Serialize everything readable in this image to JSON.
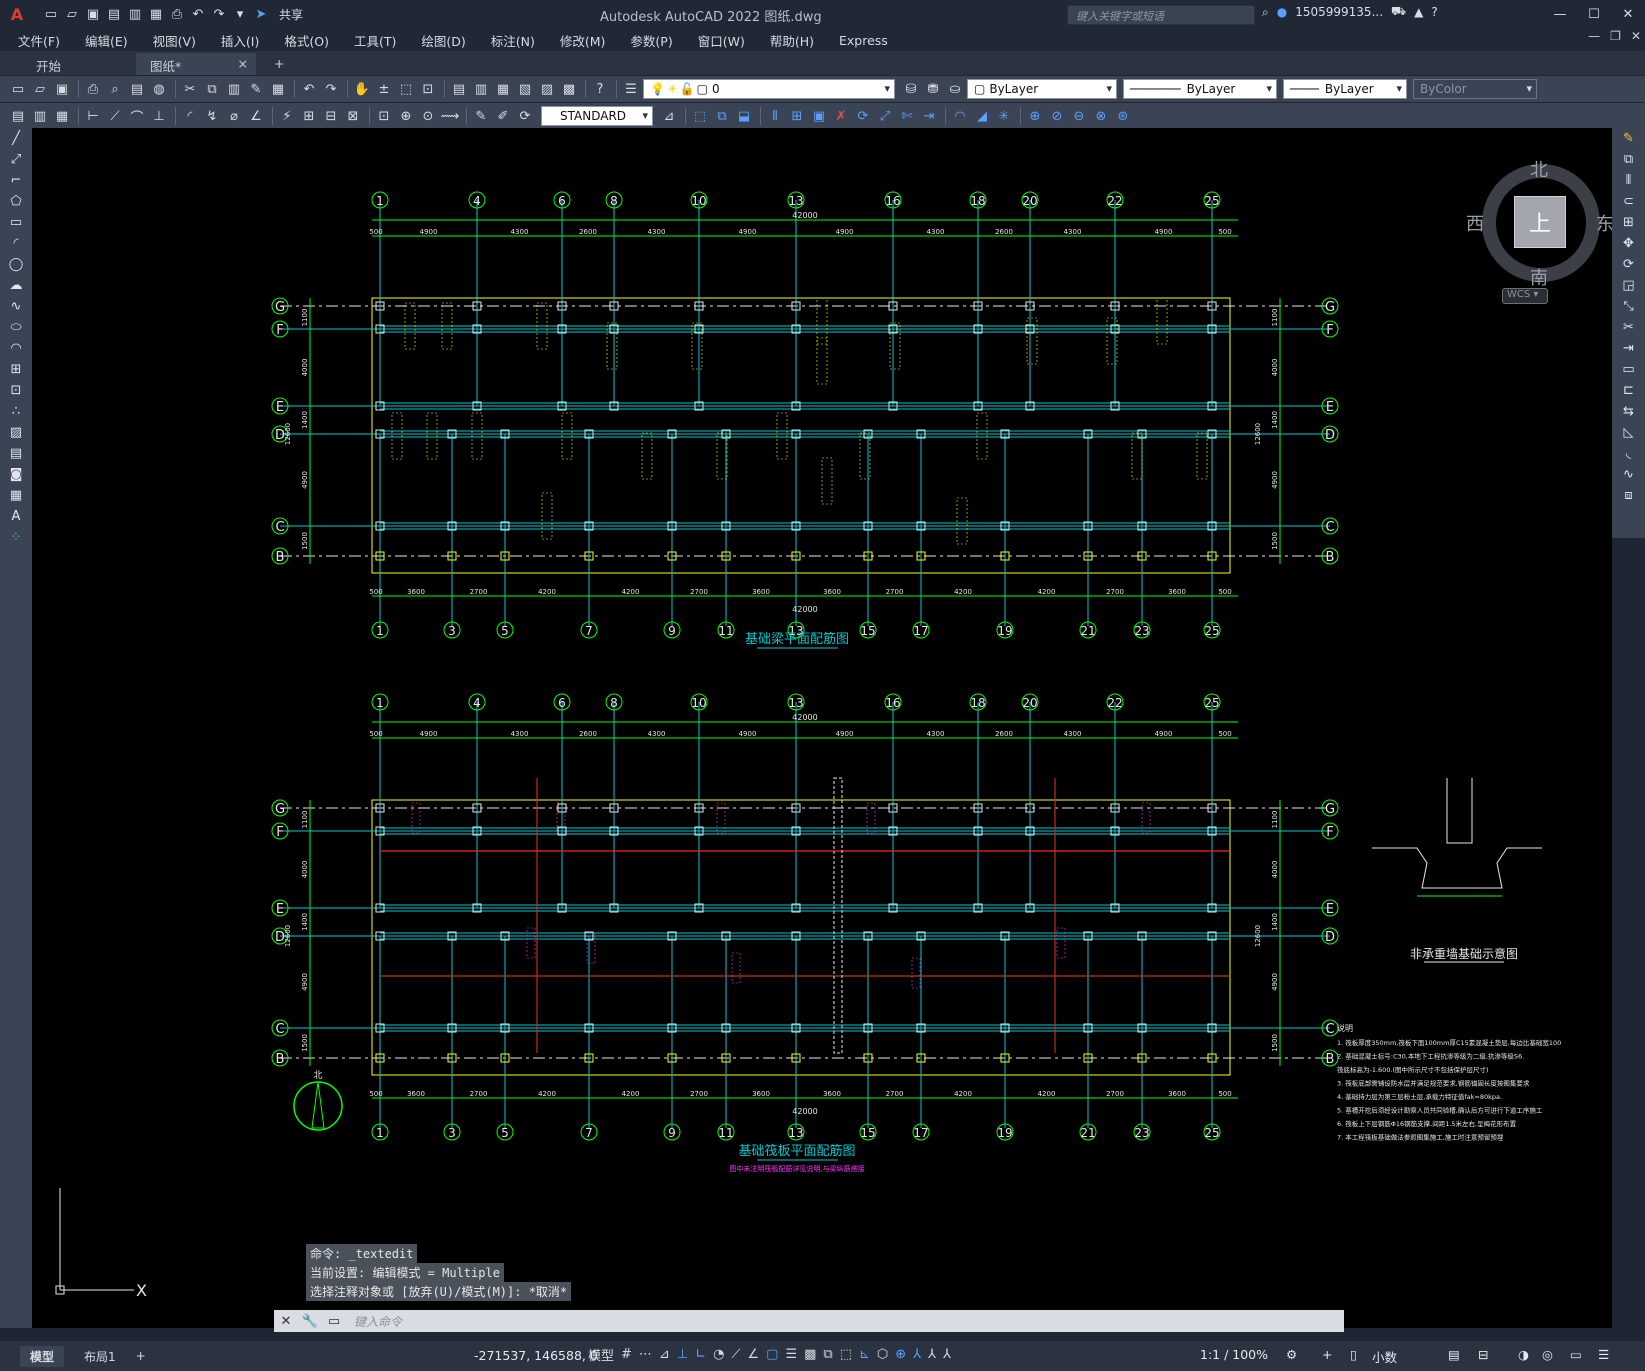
{
  "titlebar": {
    "logo": "A",
    "share_label": "共享",
    "title": "Autodesk AutoCAD 2022    图纸.dwg",
    "search_placeholder": "键入关键字或短语",
    "user": "1505999135...",
    "qat_icons": [
      "new-icon",
      "open-icon",
      "save-icon",
      "saveas-icon",
      "plot-icon",
      "print-icon",
      "undo-icon",
      "redo-icon",
      "share-icon"
    ]
  },
  "menu": [
    "文件(F)",
    "编辑(E)",
    "视图(V)",
    "插入(I)",
    "格式(O)",
    "工具(T)",
    "绘图(D)",
    "标注(N)",
    "修改(M)",
    "参数(P)",
    "窗口(W)",
    "帮助(H)",
    "Express"
  ],
  "tabs": {
    "start": "开始",
    "drawing": "图纸*",
    "close": "×",
    "add": "+"
  },
  "toolbar2": {
    "layer": "0",
    "color": "ByLayer",
    "linetype": "ByLayer",
    "lineweight": "ByLayer",
    "plotstyle": "ByColor"
  },
  "toolbar3": {
    "textstyle": "STANDARD"
  },
  "viewcube": {
    "north": "北",
    "south": "南",
    "west": "西",
    "east": "东",
    "face": "上",
    "wcs": "WCS"
  },
  "drawing": {
    "plan1_title": "基础梁平面配筋图",
    "plan2_title": "基础筏板平面配筋图",
    "plan2_sub": "图中未注明筏板配筋详见说明,与梁纵筋搭接",
    "section_title": "非承重墙基础示意图",
    "top_axes": [
      "1",
      "4",
      "6",
      "8",
      "10",
      "13",
      "16",
      "18",
      "20",
      "22",
      "25"
    ],
    "bottom_axes": [
      "1",
      "3",
      "5",
      "7",
      "9",
      "11",
      "13",
      "15",
      "17",
      "19",
      "21",
      "23",
      "25"
    ],
    "row_axes": [
      "G",
      "F",
      "E",
      "D",
      "C",
      "B"
    ],
    "top_dims": [
      "500",
      "4900",
      "4300",
      "2600",
      "4300",
      "4900",
      "4900",
      "4300",
      "2600",
      "4300",
      "4900",
      "500"
    ],
    "bottom_dims": [
      "500",
      "3600",
      "2700",
      "4200",
      "4200",
      "2700",
      "3600",
      "3600",
      "2700",
      "4200",
      "4200",
      "2700",
      "3600",
      "500"
    ],
    "total_dim": "42000",
    "left_dims": [
      "1100",
      "4000",
      "1400",
      "4900",
      "1500",
      "800"
    ],
    "left_total": "12600",
    "north_label": "北",
    "notes_title": "说明",
    "notes": [
      "1. 筏板厚度350mm,筏板下面100mm厚C15素混凝土垫层,每边比基础宽100",
      "2. 基础混凝土标号:C30,本地下工程抗渗等级为二级,抗渗等级S6.",
      "   筏底标高为-1.600.(图中所示尺寸不包括保护层尺寸)",
      "3. 筏板底部需铺设防水层并满足规范要求,钢筋锚固长度按图集要求",
      "4. 基础持力层为第三层粉土层,承载力特征值fak=80kpa.",
      "5. 基槽开挖后须经设计勘察人员共同验槽,确认后方可进行下道工序施工",
      "6. 筏板上下层钢筋Φ16钢筋支撑,间距1.5米左右,呈梅花形布置",
      "7. 本工程筏板基础做法参照图集施工,施工时注意预留预埋"
    ]
  },
  "command_history": [
    "命令: _textedit",
    "当前设置: 编辑模式 = Multiple",
    "选择注释对象或 [放弃(U)/模式(M)]: *取消*"
  ],
  "command_placeholder": "键入命令",
  "status": {
    "model_tab": "模型",
    "layout_tab": "布局1",
    "add": "+",
    "coords": "-271537, 146588, 0",
    "model": "模型",
    "scale": "1:1 / 100%",
    "units": "小数"
  }
}
